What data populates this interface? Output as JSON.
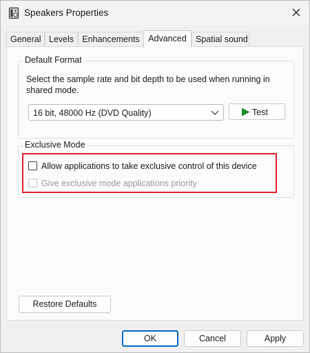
{
  "window": {
    "title": "Speakers Properties",
    "icon": "speaker-icon",
    "close_icon": "close-icon"
  },
  "tabs": [
    {
      "label": "General",
      "active": false
    },
    {
      "label": "Levels",
      "active": false
    },
    {
      "label": "Enhancements",
      "active": false
    },
    {
      "label": "Advanced",
      "active": true
    },
    {
      "label": "Spatial sound",
      "active": false
    }
  ],
  "default_format": {
    "group_label": "Default Format",
    "description": "Select the sample rate and bit depth to be used when running in shared mode.",
    "selected_format": "16 bit, 48000 Hz (DVD Quality)",
    "test_button": "Test",
    "test_icon": "play-icon"
  },
  "exclusive_mode": {
    "group_label": "Exclusive Mode",
    "allow_exclusive": {
      "label": "Allow applications to take exclusive control of this device",
      "checked": false,
      "enabled": true
    },
    "give_priority": {
      "label": "Give exclusive mode applications priority",
      "checked": false,
      "enabled": false
    }
  },
  "restore_defaults": "Restore Defaults",
  "footer": {
    "ok": "OK",
    "cancel": "Cancel",
    "apply": "Apply"
  },
  "colors": {
    "highlight": "#e0202a",
    "play_icon": "#1e8c2a",
    "default_button_border": "#0067c0"
  }
}
